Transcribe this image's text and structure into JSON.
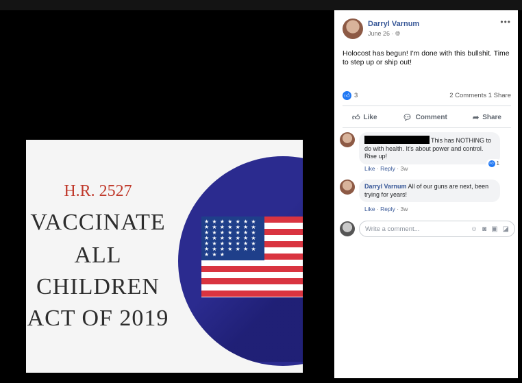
{
  "image": {
    "bill_number": "H.R. 2527",
    "lines": [
      "VACCINATE",
      "ALL",
      "CHILDREN",
      "ACT OF 2019"
    ],
    "stars": "★ ★ ★ ★ ★ ★ ★ ★ ★ ★ ★ ★ ★ ★ ★ ★ ★ ★ ★ ★ ★ ★ ★ ★ ★ ★ ★ ★ ★ ★ ★ ★ ★ ★ ★ ★ ★ ★ ★ ★ ★ ★ ★ ★ ★"
  },
  "post": {
    "author": "Darryl Varnum",
    "date": "June 26 · ",
    "audience_icon": "globe-icon",
    "text": "Holocost has begun! I'm done with this bullshit. Time to step up or ship out!",
    "like_count": "3",
    "counts": "2 Comments  1 Share",
    "more_label": "•••"
  },
  "actions": {
    "like": "Like",
    "comment": "Comment",
    "share": "Share"
  },
  "comments": [
    {
      "author": "",
      "text": "This has NOTHING to do with health. It's about power and control. Rise up!",
      "meta_like": "Like",
      "meta_reply": "Reply",
      "meta_time": "3w",
      "reaction_count": "1"
    },
    {
      "author": "Darryl Varnum",
      "text": "All of our guns are next, been trying for years!",
      "meta_like": "Like",
      "meta_reply": "Reply",
      "meta_time": "3w"
    }
  ],
  "composer": {
    "placeholder": "Write a comment..."
  },
  "colors": {
    "link": "#385898",
    "like_blue": "#2078f4",
    "circle": "#2b2b8f",
    "flag_red": "#d93440"
  }
}
